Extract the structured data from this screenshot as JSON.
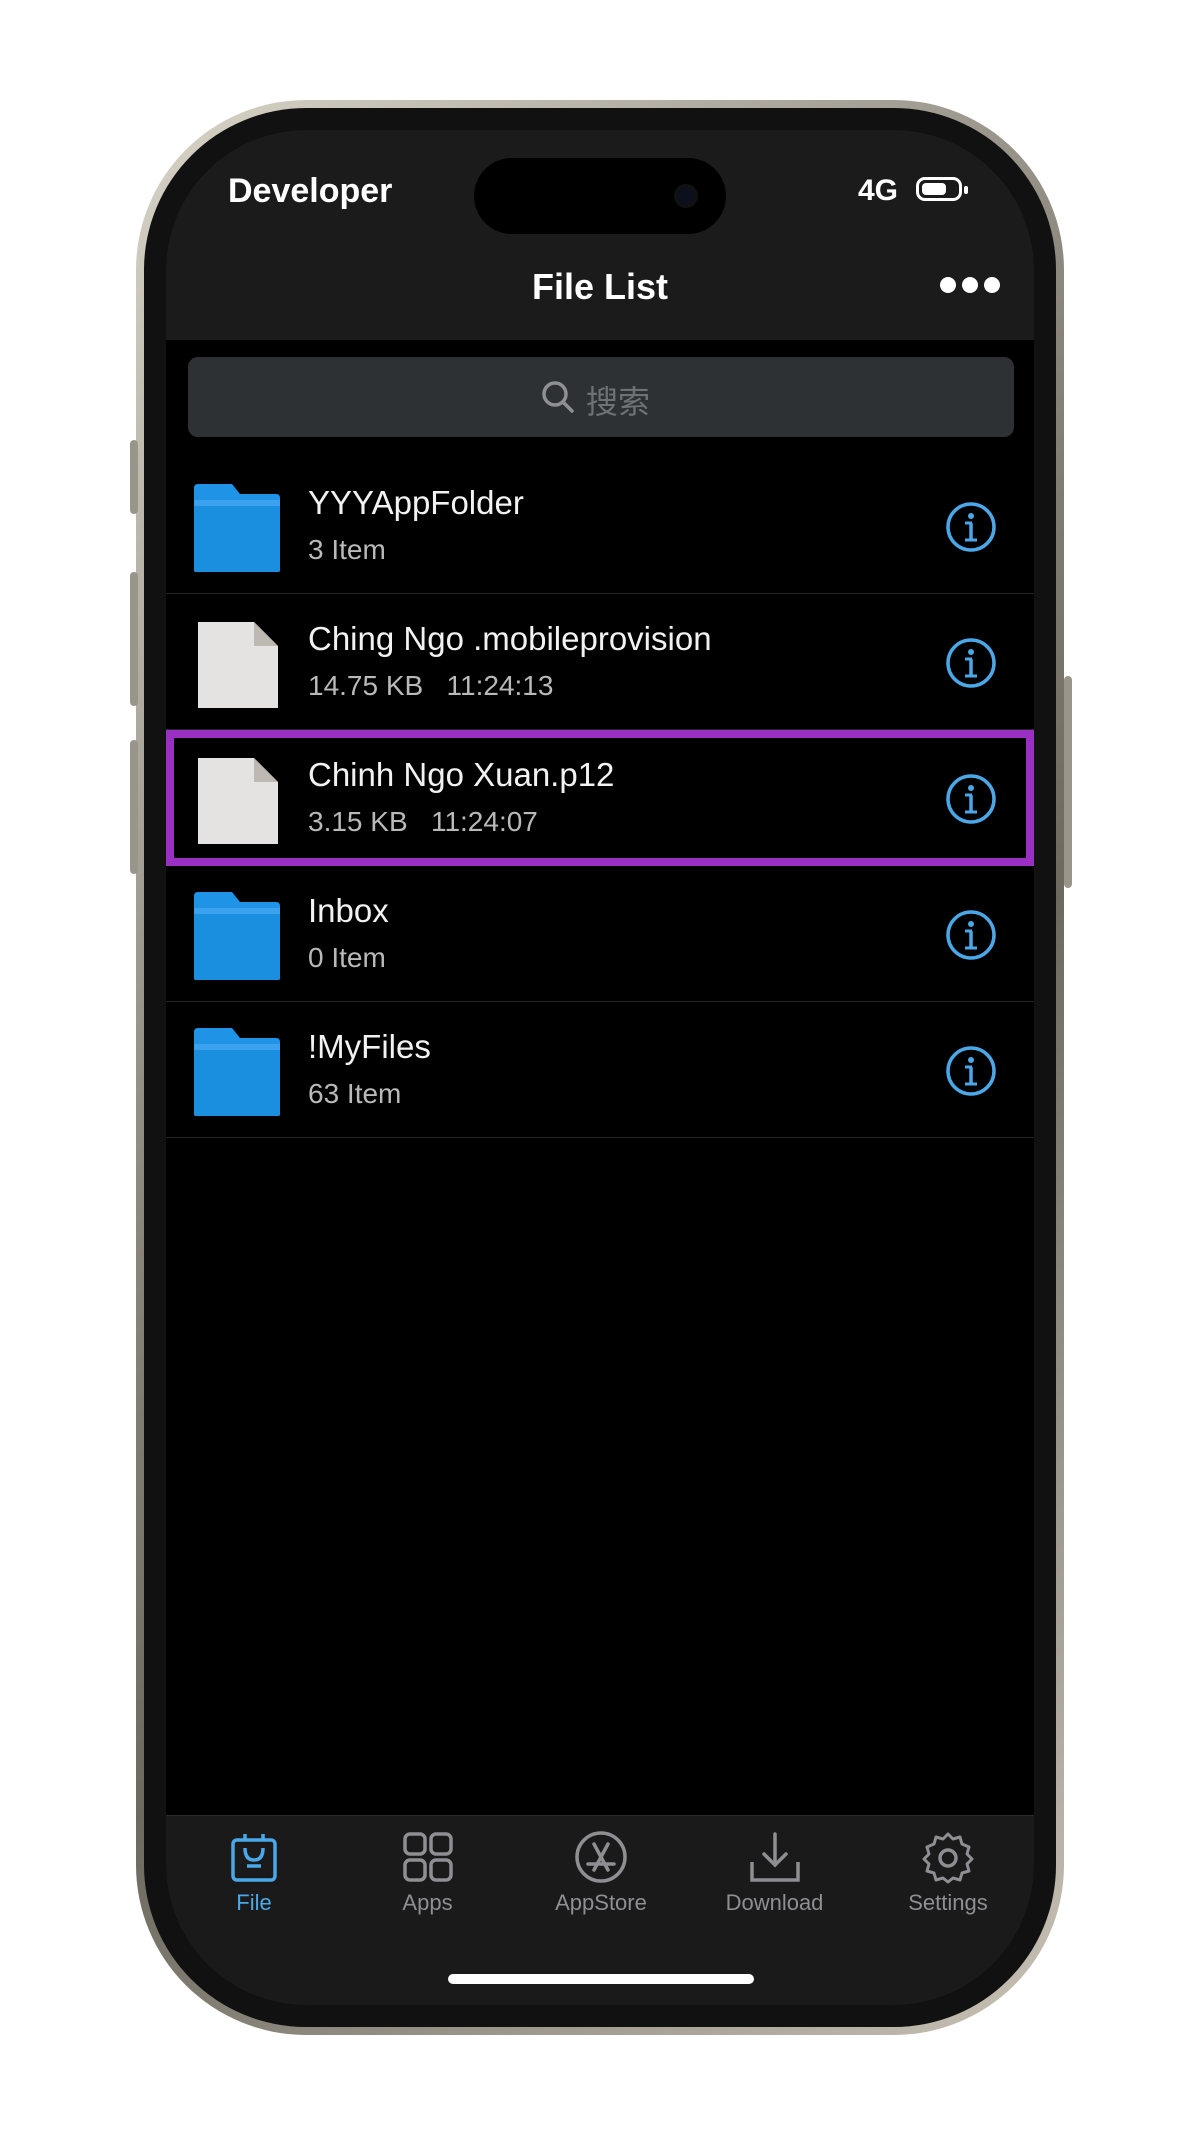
{
  "status_bar": {
    "carrier": "Developer",
    "network": "4G",
    "battery_icon": "battery-icon"
  },
  "nav": {
    "title": "File List",
    "more_icon": "ellipsis-icon"
  },
  "search": {
    "placeholder": "搜索",
    "icon": "search-icon"
  },
  "files": [
    {
      "type": "folder",
      "name": "YYYAppFolder",
      "meta": "3 Item",
      "selected": false
    },
    {
      "type": "file",
      "name": "Ching Ngo .mobileprovision",
      "meta": "14.75 KB   11:24:13",
      "selected": false
    },
    {
      "type": "file",
      "name": "Chinh Ngo Xuan.p12",
      "meta": "3.15 KB   11:24:07",
      "selected": true
    },
    {
      "type": "folder",
      "name": "Inbox",
      "meta": "0 Item",
      "selected": false
    },
    {
      "type": "folder",
      "name": "!MyFiles",
      "meta": "63 Item",
      "selected": false
    }
  ],
  "tabs": [
    {
      "label": "File",
      "icon": "file-bag-icon",
      "active": true
    },
    {
      "label": "Apps",
      "icon": "apps-grid-icon",
      "active": false
    },
    {
      "label": "AppStore",
      "icon": "appstore-icon",
      "active": false
    },
    {
      "label": "Download",
      "icon": "download-icon",
      "active": false
    },
    {
      "label": "Settings",
      "icon": "gear-icon",
      "active": false
    }
  ],
  "colors": {
    "accent": "#4aa8e8",
    "highlight": "#9a2fc4",
    "folder": "#1a8fe0",
    "background": "#000000",
    "bar": "#1b1b1b"
  }
}
